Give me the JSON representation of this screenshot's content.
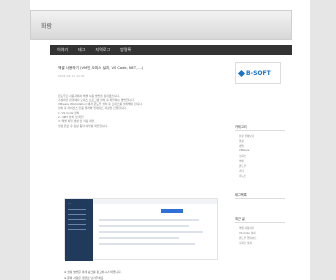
{
  "header": {
    "title": "화람"
  },
  "nav": {
    "items": [
      "이야기",
      "태그",
      "지역로그",
      "방명록"
    ]
  },
  "post": {
    "title": "엑셀 사용하기 (VM인 오피스 설치, VS Code, NET, ...)",
    "meta": "2021.03.11 11:21",
    "lines": [
      "윈도우즈 사용자에서 엑셀 사용 방법을 정리했습니다.",
      "가상머신 환경에서 오피스 프로그램 설치 후 확인하는 방법입니다.",
      "VMware Workstation 에서 윈도우 설치 후 오피스를 설치해야 합니다.",
      "설치 후 라이선스 인증 절차와 업데이트 과정을 진행합니다.",
      "1. VS Code 설치",
      "2. .NET 설치 및 확인",
      "3. 엑셀 파일 생성 및 저장 확인",
      "설정 완료 후 정상 동작 여부를 확인합니다."
    ],
    "note": "※ 설정 방법은 아래 링크를 참고하시기 바랍니다.",
    "note2": "※ 문의 사항은 댓글로 남겨주세요."
  },
  "sidebar": {
    "logo": "B-SOFT",
    "cat_head": "카테고리",
    "cats": [
      "분류 전체보기",
      "일상",
      "개발",
      "VMware",
      "오피스",
      "엑셀",
      "윈도우",
      "기타",
      "리눅스"
    ],
    "tag_head": "태그목록",
    "recent_head": "최근 글",
    "recent": [
      "엑셀 사용하기",
      "VS Code 설치",
      "윈도우 업데이트",
      "오피스 설치"
    ]
  }
}
